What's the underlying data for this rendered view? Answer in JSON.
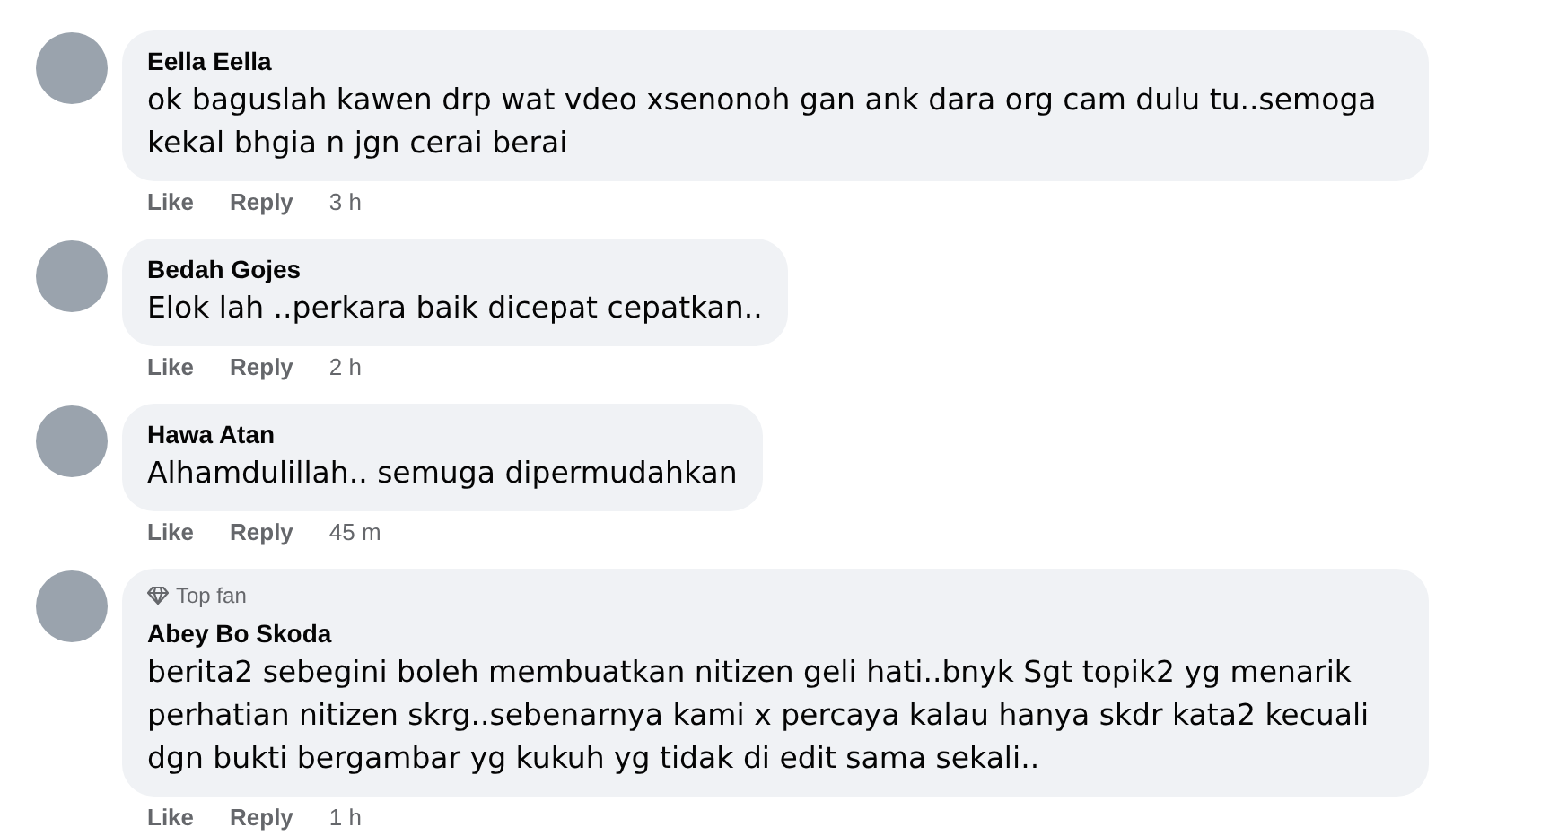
{
  "comments": [
    {
      "author": "Eella Eella",
      "text": "ok baguslah kawen drp wat vdeo xsenonoh gan ank dara org cam dulu tu..semoga kekal bhgia n jgn cerai berai",
      "like": "Like",
      "reply": "Reply",
      "time": "3 h"
    },
    {
      "author": "Bedah Gojes",
      "text": "Elok lah ..perkara baik dicepat cepatkan..",
      "like": "Like",
      "reply": "Reply",
      "time": "2 h"
    },
    {
      "author": "Hawa Atan",
      "text": "Alhamdulillah.. semuga dipermudahkan",
      "like": "Like",
      "reply": "Reply",
      "time": "45 m"
    },
    {
      "author": "Abey Bo Skoda",
      "badge": "Top fan",
      "text": "berita2 sebegini boleh membuatkan nitizen geli hati..bnyk Sgt topik2 yg menarik perhatian nitizen skrg..sebenarnya kami x percaya kalau hanya skdr kata2 kecuali dgn bukti bergambar yg kukuh yg tidak di edit sama sekali..",
      "like": "Like",
      "reply": "Reply",
      "time": "1 h"
    }
  ]
}
